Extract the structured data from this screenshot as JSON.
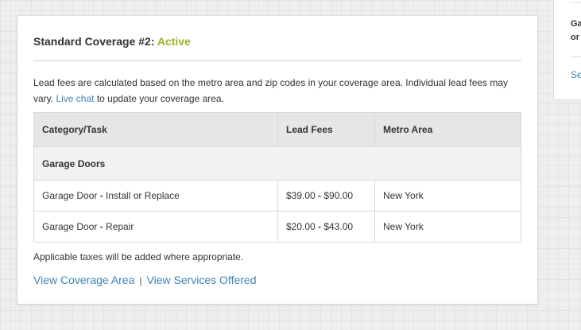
{
  "coverage": {
    "title": "Standard Coverage #2:",
    "status": "Active",
    "description_before": "Lead fees are calculated based on the metro area and zip codes in your coverage area. Individual lead fees may vary. ",
    "live_chat_label": "Live chat",
    "description_after": " to update your coverage area.",
    "table": {
      "headers": [
        "Category/Task",
        "Lead Fees",
        "Metro Area"
      ],
      "group": "Garage Doors",
      "rows": [
        {
          "task": "Garage Door - Install or Replace",
          "fee": "$39.00 - $90.00",
          "metro": "New York"
        },
        {
          "task": "Garage Door - Repair",
          "fee": "$20.00 - $43.00",
          "metro": "New York"
        }
      ]
    },
    "taxes_note": "Applicable taxes will be added where appropriate.",
    "view_coverage_label": "View Coverage Area",
    "separator": "|",
    "view_services_label": "View Services Offered"
  },
  "sidebar": {
    "title_partial": "Ga or",
    "link_partial": "Se"
  },
  "colors": {
    "status_active": "#9bb523",
    "link": "#3e83b5"
  }
}
